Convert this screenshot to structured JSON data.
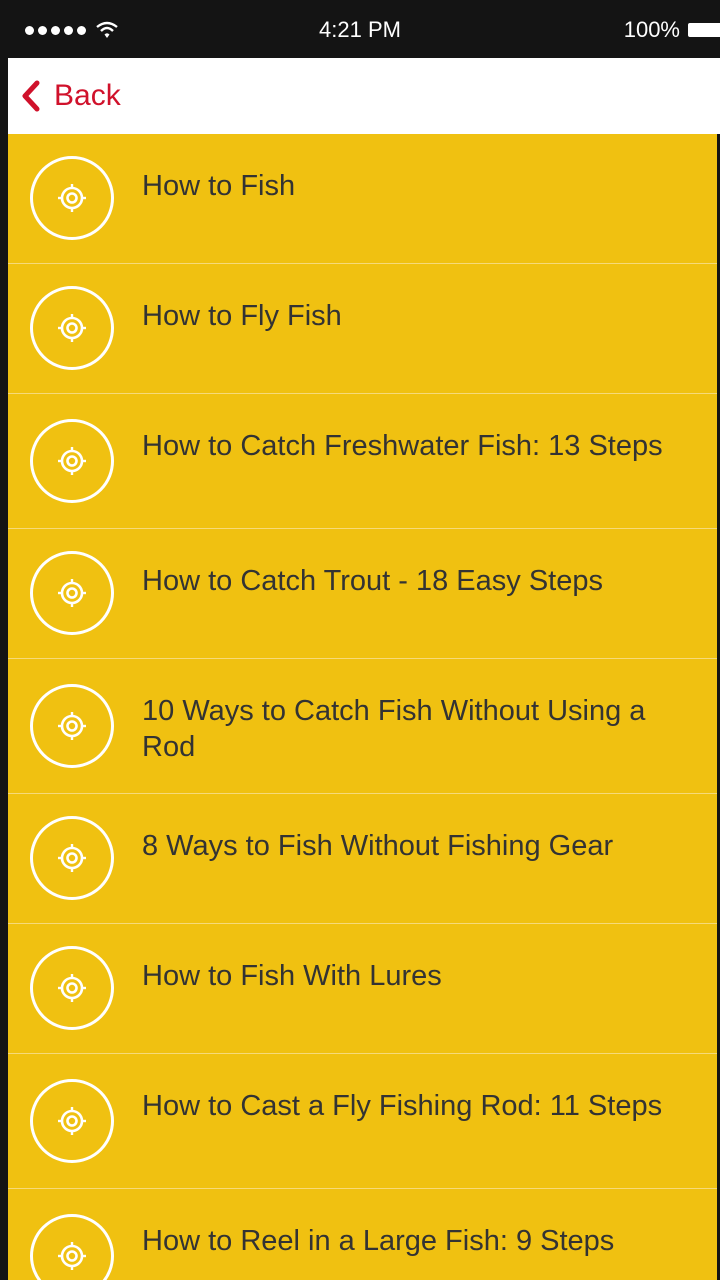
{
  "status_bar": {
    "time": "4:21 PM",
    "battery": "100%",
    "signal_icon": "signal-dots-icon",
    "wifi_icon": "wifi-icon",
    "battery_icon": "battery-icon"
  },
  "nav": {
    "back_label": "Back",
    "back_icon": "chevron-left-icon",
    "accent_color": "#d0112b"
  },
  "list": {
    "background_color": "#f0c111",
    "item_icon": "target-icon",
    "items": [
      {
        "label": "How to Fish"
      },
      {
        "label": "How to Fly Fish"
      },
      {
        "label": "How to Catch Freshwater Fish: 13 Steps"
      },
      {
        "label": "How to Catch Trout - 18 Easy Steps"
      },
      {
        "label": "10 Ways to Catch Fish Without Using a Rod"
      },
      {
        "label": "8 Ways to Fish Without Fishing Gear"
      },
      {
        "label": "How to Fish With Lures"
      },
      {
        "label": "How to Cast a Fly Fishing Rod: 11 Steps"
      },
      {
        "label": "How to Reel in a Large Fish: 9 Steps"
      }
    ]
  }
}
